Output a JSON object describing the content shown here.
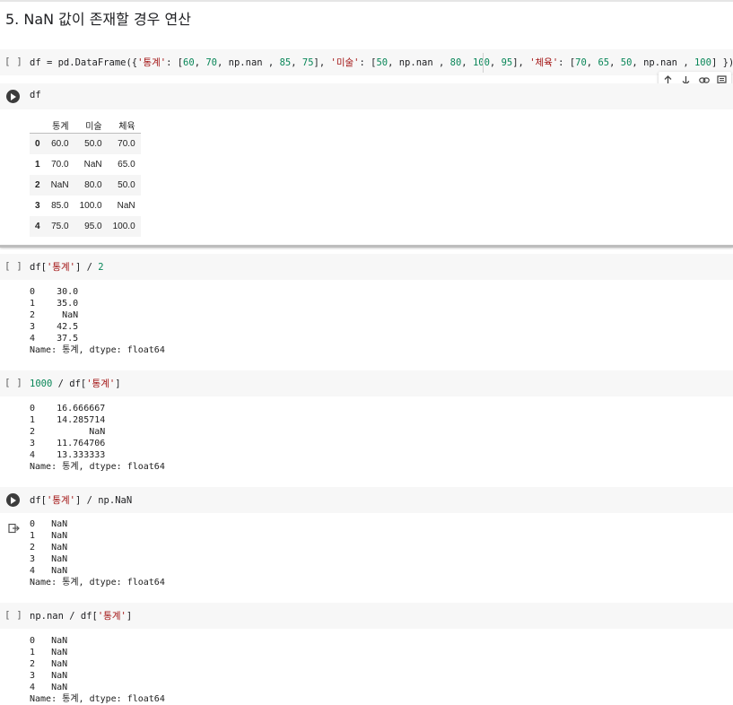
{
  "heading": "5. NaN 값이 존재할 경우 연산",
  "cells": {
    "c1": {
      "brackets": "[ ]"
    },
    "c2": {
      "code": "df"
    },
    "c3": {
      "brackets": "[ ]"
    },
    "c4": {
      "brackets": "[ ]"
    },
    "c5": {
      "code": "df['통계'] / np.NaN"
    },
    "c6": {
      "brackets": "[ ]"
    }
  },
  "code_tokens": {
    "c1": [
      "df = pd.DataFrame({",
      "'통계'",
      ": [",
      "60",
      ", ",
      "70",
      ", np.nan , ",
      "85",
      ", ",
      "75",
      "], ",
      "'미술'",
      ": [",
      "50",
      ", np.nan , ",
      "80",
      ", ",
      "100",
      ", ",
      "95",
      "], ",
      "'체육'",
      ": [",
      "70",
      ", ",
      "65",
      ", ",
      "50",
      ", np.nan , ",
      "100",
      "] })"
    ],
    "c3": [
      "df[",
      "'통계'",
      "] / ",
      "2"
    ],
    "c4": [
      "1000",
      " / df[",
      "'통계'",
      "]"
    ],
    "c5": [
      "df[",
      "'통계'",
      "] / np.NaN"
    ],
    "c6": [
      "np.nan / df[",
      "'통계'",
      "]"
    ]
  },
  "dataframe": {
    "columns": [
      "",
      "통계",
      "미술",
      "체육"
    ],
    "rows": [
      [
        "0",
        "60.0",
        "50.0",
        "70.0"
      ],
      [
        "1",
        "70.0",
        "NaN",
        "65.0"
      ],
      [
        "2",
        "NaN",
        "80.0",
        "50.0"
      ],
      [
        "3",
        "85.0",
        "100.0",
        "NaN"
      ],
      [
        "4",
        "75.0",
        "95.0",
        "100.0"
      ]
    ]
  },
  "outputs": {
    "c3": "0    30.0\n1    35.0\n2     NaN\n3    42.5\n4    37.5\nName: 통계, dtype: float64",
    "c4": "0    16.666667\n1    14.285714\n2          NaN\n3    11.764706\n4    13.333333\nName: 통계, dtype: float64",
    "c5": "0   NaN\n1   NaN\n2   NaN\n3   NaN\n4   NaN\nName: 통계, dtype: float64",
    "c6": "0   NaN\n1   NaN\n2   NaN\n3   NaN\n4   NaN\nName: 통계, dtype: float64"
  },
  "toolbar_icons": [
    "arrow-up-icon",
    "arrow-down-icon",
    "link-icon",
    "comment-icon"
  ]
}
